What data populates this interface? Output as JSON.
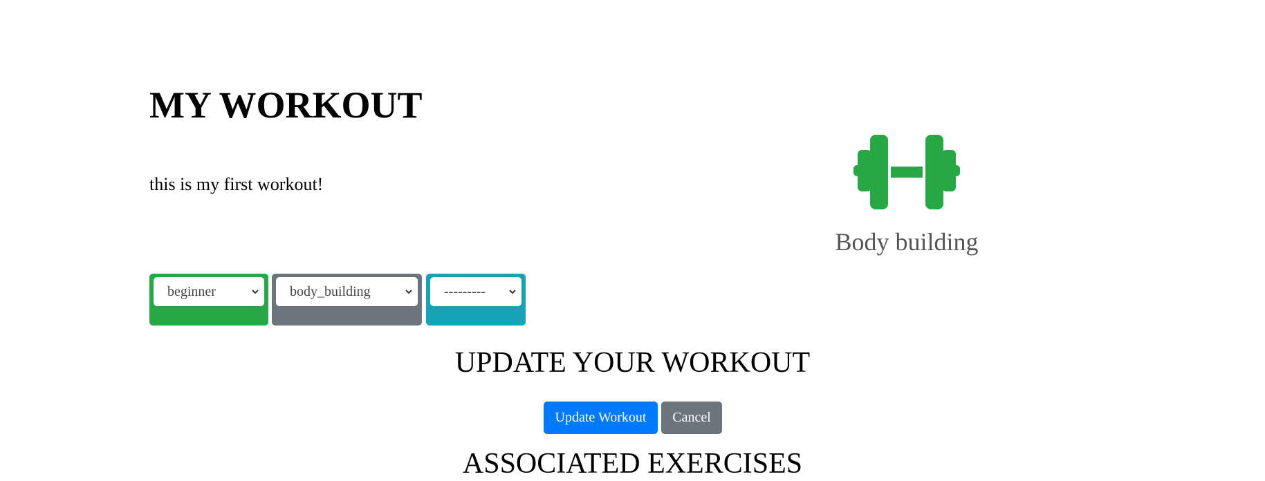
{
  "workout": {
    "title": "MY WORKOUT",
    "description": "this is my first workout!"
  },
  "category_display": {
    "icon": "dumbbell-icon",
    "label": "Body building",
    "icon_color": "#28a745"
  },
  "filters": {
    "difficulty": {
      "selected": "beginner",
      "color": "#28a745"
    },
    "category": {
      "selected": "body_building",
      "color": "#6c757d"
    },
    "exercise": {
      "selected": "---------",
      "color": "#17a2b8"
    }
  },
  "update_section": {
    "heading": "UPDATE YOUR WORKOUT",
    "update_label": "Update Workout",
    "cancel_label": "Cancel",
    "update_color": "#007bff",
    "cancel_color": "#6c757d"
  },
  "exercises_section": {
    "heading": "ASSOCIATED EXERCISES"
  }
}
